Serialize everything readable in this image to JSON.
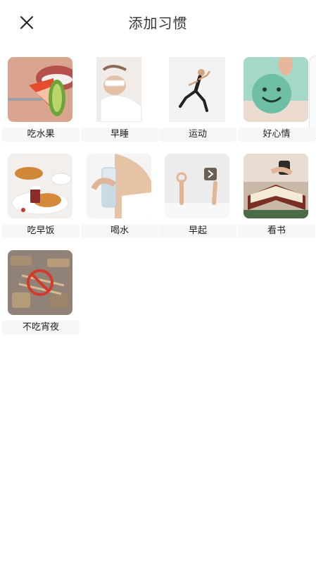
{
  "header": {
    "title": "添加习惯",
    "close_icon": "close-icon"
  },
  "habits": [
    {
      "label": "吃水果",
      "icon": "fruit-photo"
    },
    {
      "label": "早睡",
      "icon": "sleep-photo"
    },
    {
      "label": "运动",
      "icon": "exercise-photo"
    },
    {
      "label": "好心情",
      "icon": "smile-photo"
    },
    {
      "label": "吃早饭",
      "icon": "breakfast-photo"
    },
    {
      "label": "喝水",
      "icon": "water-photo"
    },
    {
      "label": "早起",
      "icon": "wake-up-photo"
    },
    {
      "label": "看书",
      "icon": "reading-photo"
    },
    {
      "label": "不吃宵夜",
      "icon": "no-late-snack-photo"
    }
  ]
}
